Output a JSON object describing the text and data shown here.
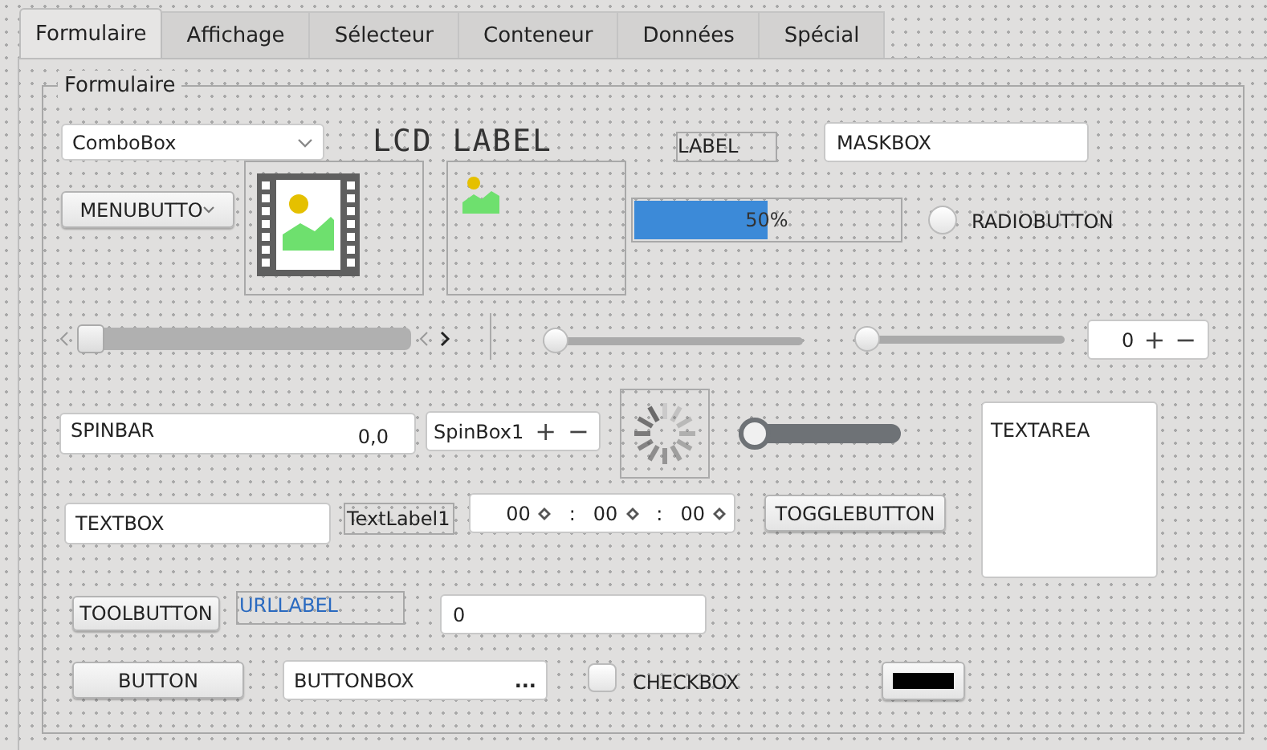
{
  "tabs": [
    {
      "label": "Formulaire",
      "selected": true
    },
    {
      "label": "Affichage",
      "selected": false
    },
    {
      "label": "Sélecteur",
      "selected": false
    },
    {
      "label": "Conteneur",
      "selected": false
    },
    {
      "label": "Données",
      "selected": false
    },
    {
      "label": "Spécial",
      "selected": false
    }
  ],
  "group": {
    "title": "Formulaire"
  },
  "combobox": {
    "value": "ComboBox"
  },
  "lcd_label": "LCD LABEL",
  "label": "LABEL",
  "maskbox": {
    "value": "MASKBOX"
  },
  "menubutton": {
    "label": "MENUBUTTO"
  },
  "progress": {
    "level": 0.5,
    "text": "50%"
  },
  "radio": {
    "label": "RADIOBUTTON",
    "checked": false
  },
  "scrollbar": {
    "level": 0
  },
  "slider_1": {
    "level": 0
  },
  "slider_2": {
    "level": 0
  },
  "spinbox_small": {
    "value": "0",
    "plus": "+",
    "minus": "−"
  },
  "spinbar": {
    "label": "SPINBAR",
    "value": "0,0"
  },
  "spinbox_1": {
    "value": "SpinBox1",
    "plus": "+",
    "minus": "−"
  },
  "switch": {
    "on": false
  },
  "textarea": {
    "value": "TEXTAREA"
  },
  "textbox": {
    "value": "TEXTBOX"
  },
  "text_label": "TextLabel1",
  "time_edit": {
    "parts": [
      "00",
      "00",
      "00"
    ],
    "separators": [
      ":",
      ":"
    ]
  },
  "togglebutton": {
    "label": "TOGGLEBUTTON"
  },
  "toolbutton": {
    "label": "TOOLBUTTON"
  },
  "url_label": "URLLABEL",
  "number_field": {
    "value": "0"
  },
  "button": {
    "label": "BUTTON"
  },
  "buttonbox": {
    "value": "BUTTONBOX",
    "button": "..."
  },
  "checkbox": {
    "label": "CHECKBOX",
    "checked": false
  },
  "color_button": {
    "color": "#000000"
  }
}
